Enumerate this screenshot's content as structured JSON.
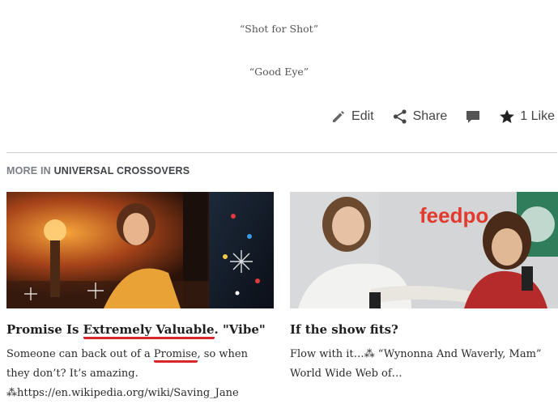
{
  "quotes": [
    "“Shot for Shot”",
    "“Good Eye”"
  ],
  "actions": {
    "edit_label": "Edit",
    "share_label": "Share",
    "like_label": "1 Like"
  },
  "more": {
    "prefix": "MORE IN",
    "category": "UNIVERSAL CROSSOVERS"
  },
  "cards": [
    {
      "title_prefix": "Promise Is ",
      "title_highlight": "Extremely Valuable",
      "title_suffix": ". \"Vibe\"",
      "excerpt_line1_prefix": "Someone can back out of a ",
      "excerpt_line1_highlight": "Promise",
      "excerpt_line1_suffix": ", so when",
      "excerpt_line2": "they don’t? It’s amazing.",
      "excerpt_line3": "⁂https://en.wikipedia.org/wiki/Saving_Jane"
    },
    {
      "title": "If the show fits?",
      "excerpt_line1": "Flow with it…⁂ “Wynonna And Waverly, Mam”",
      "excerpt_line2": "World Wide Web of…",
      "banner_text": "feedpo"
    }
  ],
  "colors": {
    "underline_red": "#d9262b",
    "divider": "#c9ccd0"
  }
}
